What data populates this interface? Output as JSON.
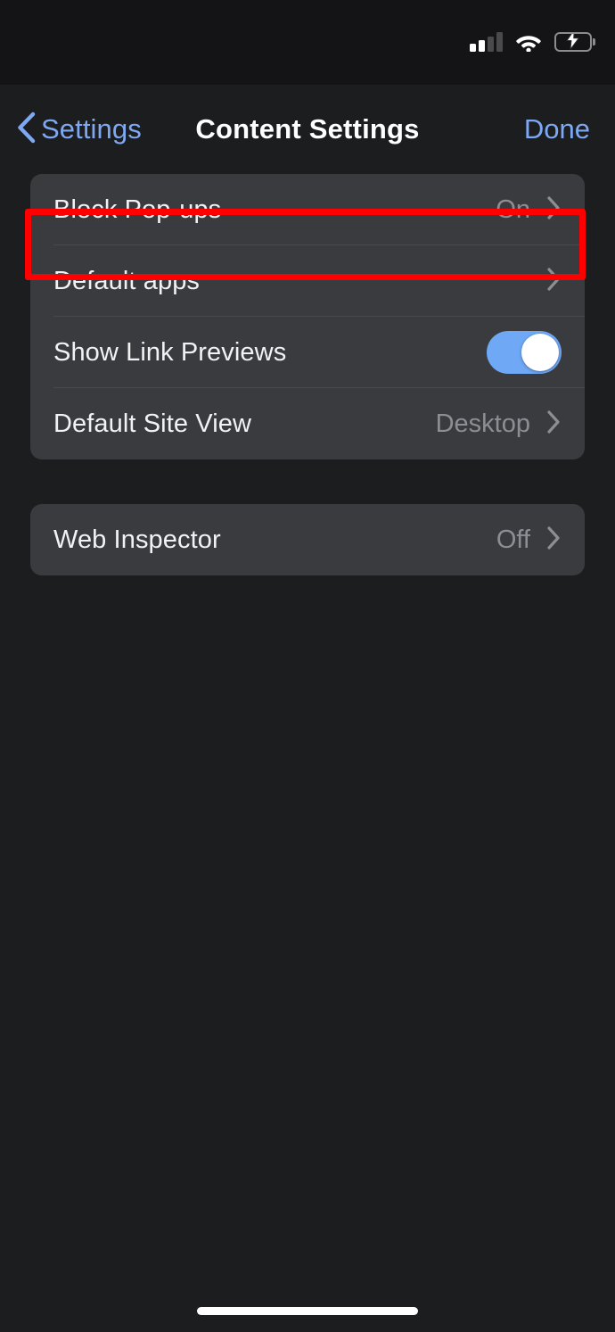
{
  "status_bar": {
    "signal_icon": "cellular-signal-icon",
    "signal_bars_total": 4,
    "signal_bars_filled": 2,
    "wifi_icon": "wifi-icon",
    "battery_icon": "battery-charging-icon",
    "battery_fill_percent": 45,
    "battery_color": "#33d158",
    "charging": true
  },
  "nav": {
    "back_icon": "chevron-left-icon",
    "back_label": "Settings",
    "title": "Content Settings",
    "done_label": "Done",
    "accent_color": "#7fa8f2"
  },
  "groups": [
    {
      "rows": [
        {
          "label": "Block Pop-ups",
          "value": "On",
          "accessory": "chevron-right-icon",
          "highlighted": true
        },
        {
          "label": "Default apps",
          "value": "",
          "accessory": "chevron-right-icon",
          "highlighted": false
        },
        {
          "label": "Show Link Previews",
          "value": "",
          "accessory": "toggle",
          "toggle_on": true,
          "highlighted": false
        },
        {
          "label": "Default Site View",
          "value": "Desktop",
          "accessory": "chevron-right-icon",
          "highlighted": false
        }
      ]
    },
    {
      "rows": [
        {
          "label": "Web Inspector",
          "value": "Off",
          "accessory": "chevron-right-icon",
          "highlighted": false
        }
      ]
    }
  ],
  "annotation": {
    "target": "Block Pop-ups",
    "color": "#fe0000"
  },
  "home_indicator": "home-indicator-bar"
}
